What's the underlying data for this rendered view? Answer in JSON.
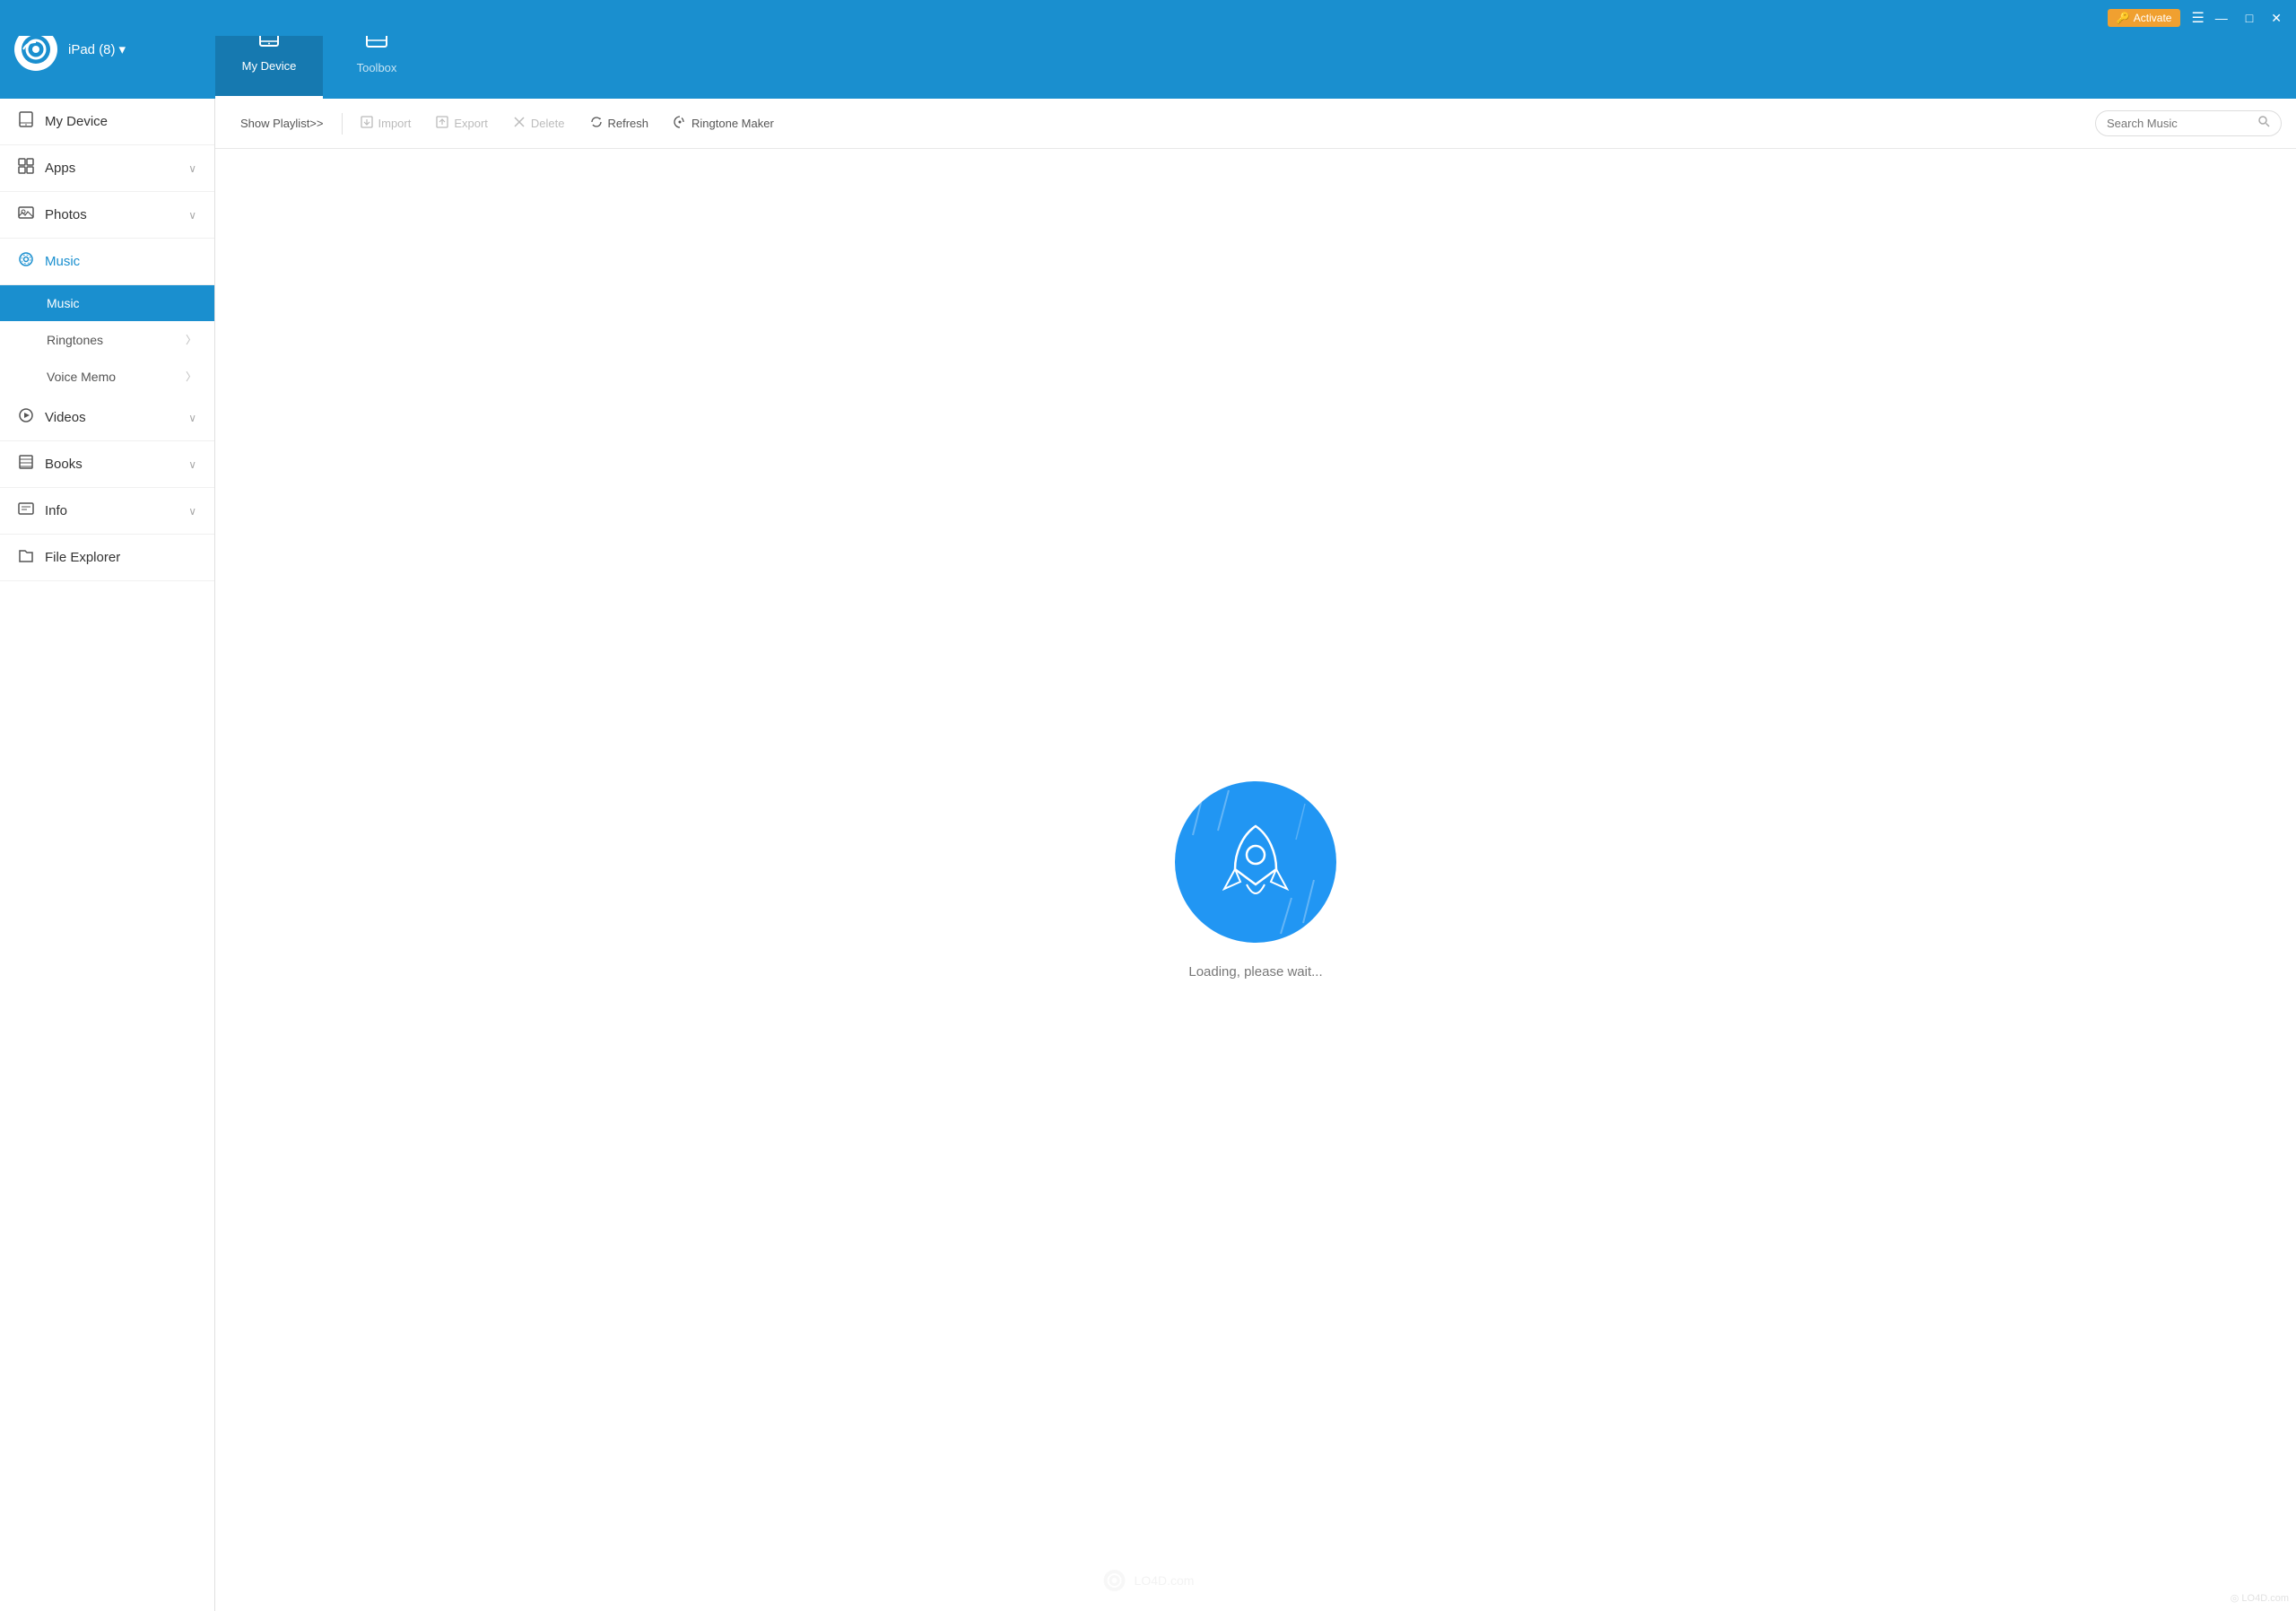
{
  "titlebar": {
    "activate_label": "Activate",
    "min_label": "—",
    "max_label": "□",
    "close_label": "✕"
  },
  "header": {
    "device_name": "iPad (8)",
    "tabs": [
      {
        "id": "my-device",
        "label": "My Device",
        "icon": "tablet"
      },
      {
        "id": "toolbox",
        "label": "Toolbox",
        "icon": "toolbox"
      }
    ]
  },
  "sidebar": {
    "items": [
      {
        "id": "my-device",
        "label": "My Device",
        "icon": "📱",
        "has_chevron": false,
        "active": false
      },
      {
        "id": "apps",
        "label": "Apps",
        "icon": "⊞",
        "has_chevron": true,
        "active": false
      },
      {
        "id": "photos",
        "label": "Photos",
        "icon": "🖼",
        "has_chevron": true,
        "active": false
      },
      {
        "id": "music",
        "label": "Music",
        "icon": "⊙",
        "has_chevron": false,
        "active": true
      }
    ],
    "music_sub": [
      {
        "id": "music-sub",
        "label": "Music",
        "active": true
      },
      {
        "id": "ringtones",
        "label": "Ringtones",
        "active": false
      },
      {
        "id": "voice-memo",
        "label": "Voice Memo",
        "active": false
      }
    ],
    "items2": [
      {
        "id": "videos",
        "label": "Videos",
        "icon": "▷",
        "has_chevron": true,
        "active": false
      },
      {
        "id": "books",
        "label": "Books",
        "icon": "☰",
        "has_chevron": true,
        "active": false
      },
      {
        "id": "info",
        "label": "Info",
        "icon": "💬",
        "has_chevron": true,
        "active": false
      },
      {
        "id": "file-explorer",
        "label": "File Explorer",
        "icon": "🗁",
        "has_chevron": false,
        "active": false
      }
    ]
  },
  "toolbar": {
    "show_playlist_label": "Show Playlist>>",
    "import_label": "Import",
    "export_label": "Export",
    "delete_label": "Delete",
    "refresh_label": "Refresh",
    "ringtone_maker_label": "Ringtone Maker",
    "search_placeholder": "Search Music"
  },
  "content": {
    "loading_text": "Loading, please wait..."
  }
}
